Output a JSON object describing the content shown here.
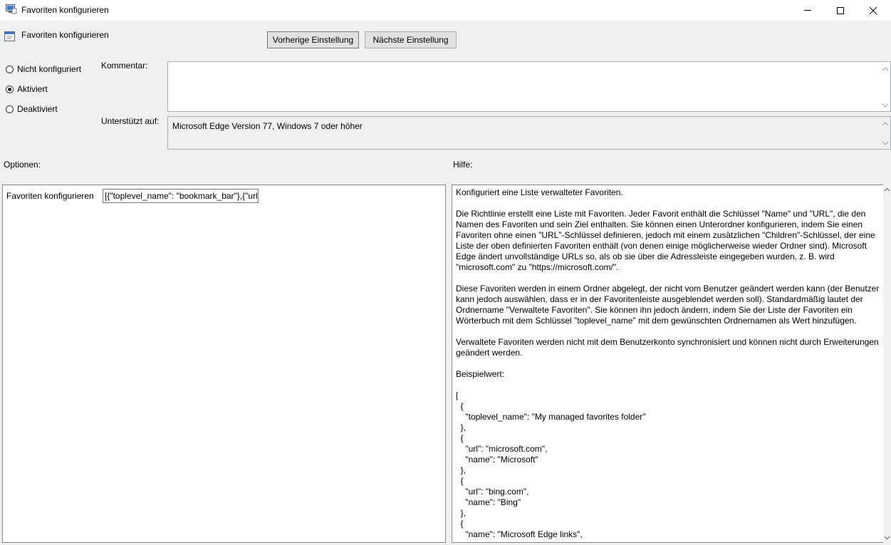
{
  "window": {
    "title": "Favoriten konfigurieren"
  },
  "header": {
    "title": "Favoriten konfigurieren",
    "prev_label": "Vorherige Einstellung",
    "next_label": "Nächste Einstellung"
  },
  "state": {
    "options": [
      {
        "label": "Nicht konfiguriert",
        "checked": false
      },
      {
        "label": "Aktiviert",
        "checked": true
      },
      {
        "label": "Deaktiviert",
        "checked": false
      }
    ]
  },
  "comment": {
    "label": "Kommentar:",
    "value": ""
  },
  "supported": {
    "label": "Unterstützt auf:",
    "value": "Microsoft Edge Version 77, Windows 7 oder höher"
  },
  "options_panel": {
    "heading": "Optionen:",
    "field_label": "Favoriten konfigurieren",
    "field_value": "[{\"toplevel_name\": \"bookmark_bar\"},{\"url\""
  },
  "help_panel": {
    "heading": "Hilfe:",
    "text": "Konfiguriert eine Liste verwalteter Favoriten.\n\nDie Richtlinie erstellt eine Liste mit Favoriten. Jeder Favorit enthält die Schlüssel \"Name\" und \"URL\", die den Namen des Favoriten und sein Ziel enthalten. Sie können einen Unterordner konfigurieren, indem Sie einen Favoriten ohne einen \"URL\"-Schlüssel definieren, jedoch mit einem zusätzlichen \"Children\"-Schlüssel, der eine Liste der oben definierten Favoriten enthält (von denen einige möglicherweise wieder Ordner sind). Microsoft Edge ändert unvollständige URLs so, als ob sie über die Adressleiste eingegeben wurden, z. B. wird \"microsoft.com\" zu \"https://microsoft.com/\".\n\nDiese Favoriten werden in einem Ordner abgelegt, der nicht vom Benutzer geändert werden kann (der Benutzer kann jedoch auswählen, dass er in der Favoritenleiste ausgeblendet werden soll). Standardmäßig lautet der Ordnername \"Verwaltete Favoriten\". Sie können ihn jedoch ändern, indem Sie der Liste der Favoriten ein Wörterbuch mit dem Schlüssel \"toplevel_name\" mit dem gewünschten Ordnernamen als Wert hinzufügen.\n\nVerwaltete Favoriten werden nicht mit dem Benutzerkonto synchronisiert und können nicht durch Erweiterungen geändert werden.\n\nBeispielwert:\n\n[\n  {\n    \"toplevel_name\": \"My managed favorites folder\"\n  },\n  {\n    \"url\": \"microsoft.com\",\n    \"name\": \"Microsoft\"\n  },\n  {\n    \"url\": \"bing.com\",\n    \"name\": \"Bing\"\n  },\n  {\n    \"name\": \"Microsoft Edge links\","
  },
  "icons": {
    "app": "policy-window-icon",
    "header": "policy-setting-icon"
  },
  "colors": {
    "window_bg": "#f0f0f0",
    "titlebar_bg": "#ffffff",
    "panel_border": "#828790"
  }
}
